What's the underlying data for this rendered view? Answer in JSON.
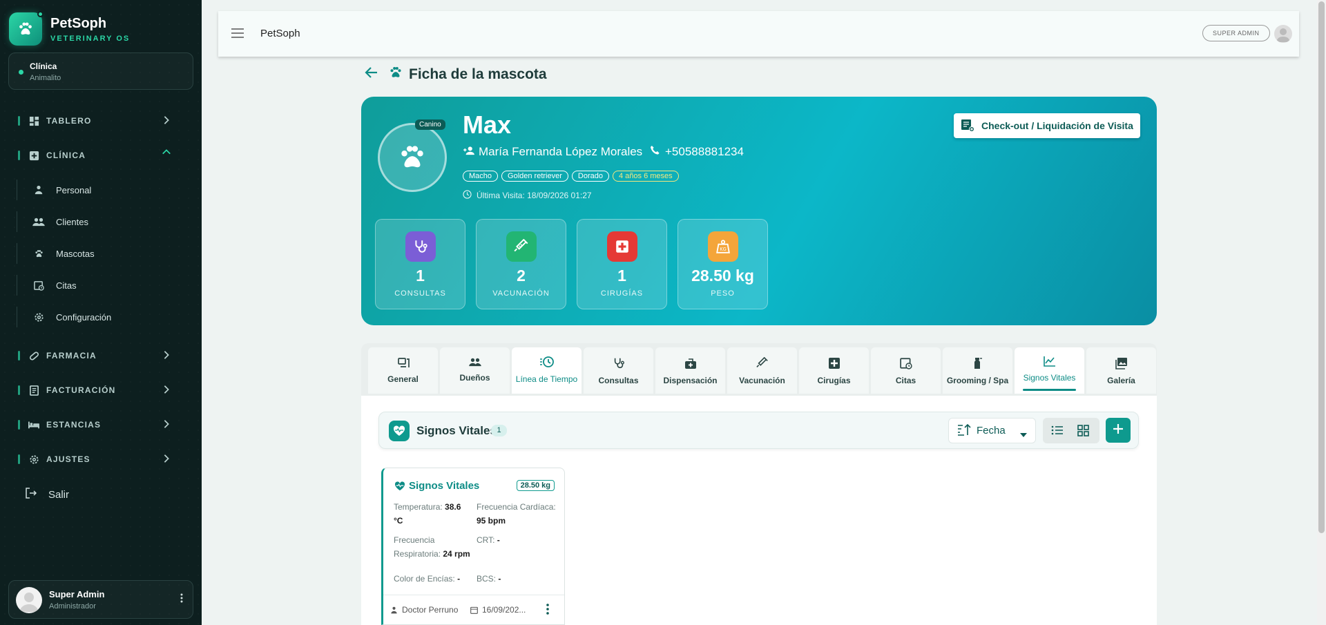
{
  "app": {
    "brand_title": "PetSoph",
    "brand_sub": "VETERINARY OS",
    "clinic_label": "Clínica",
    "clinic_name": "Animalito"
  },
  "sidebar": {
    "sections": {
      "tablero": "TABLERO",
      "clinica": "CLÍNICA",
      "farmacia": "FARMACIA",
      "facturacion": "FACTURACIÓN",
      "estancias": "ESTANCIAS",
      "ajustes": "AJUSTES"
    },
    "clinica_items": [
      "Personal",
      "Clientes",
      "Mascotas",
      "Citas",
      "Configuración"
    ],
    "logout": "Salir",
    "user_name": "Super Admin",
    "user_role": "Administrador"
  },
  "topbar": {
    "title": "PetSoph",
    "role_badge": "SUPER ADMIN"
  },
  "page": {
    "title": "Ficha de la mascota"
  },
  "pet": {
    "species": "Canino",
    "name": "Max",
    "owner": "María Fernanda López Morales",
    "phone": "+50588881234",
    "tags": [
      "Macho",
      "Golden retriever",
      "Dorado"
    ],
    "age": "4 años 6 meses",
    "last_visit": "Última Visita: 18/09/2026 01:27",
    "checkout_label": "Check-out / Liquidación de Visita"
  },
  "stats": [
    {
      "value": "1",
      "label": "CONSULTAS",
      "color": "#7b5ed6",
      "icon": "stethoscope-icon"
    },
    {
      "value": "2",
      "label": "VACUNACIÓN",
      "color": "#22b573",
      "icon": "syringe-icon"
    },
    {
      "value": "1",
      "label": "CIRUGÍAS",
      "color": "#e53935",
      "icon": "medical-cross-icon"
    },
    {
      "value": "28.50 kg",
      "label": "PESO",
      "color": "#f4a53a",
      "icon": "weight-icon"
    }
  ],
  "tabs": [
    "General",
    "Dueños",
    "Línea de Tiempo",
    "Consultas",
    "Dispensación",
    "Vacunación",
    "Cirugías",
    "Citas",
    "Grooming / Spa",
    "Signos Vitales",
    "Galería"
  ],
  "active_tab": "Signos Vitales",
  "section": {
    "title": "Signos Vitales",
    "count": "1",
    "sort_label": "Fecha"
  },
  "vitals_card": {
    "title": "Signos Vitales",
    "weight": "28.50 kg",
    "temp_label": "Temperatura:",
    "temp_value": "38.6 °C",
    "fc_label": "Frecuencia Cardíaca:",
    "fc_value": "95 bpm",
    "fr_label": "Frecuencia Respiratoria:",
    "fr_value": "24 rpm",
    "crt_label": "CRT:",
    "crt_value": "-",
    "gum_label": "Color de Encías:",
    "gum_value": "-",
    "bcs_label": "BCS:",
    "bcs_value": "-",
    "doctor": "Doctor Perruno",
    "date": "16/09/202..."
  },
  "colors": {
    "accent": "#0e9a8e",
    "sidebar_bg": "#0d1f1f"
  }
}
